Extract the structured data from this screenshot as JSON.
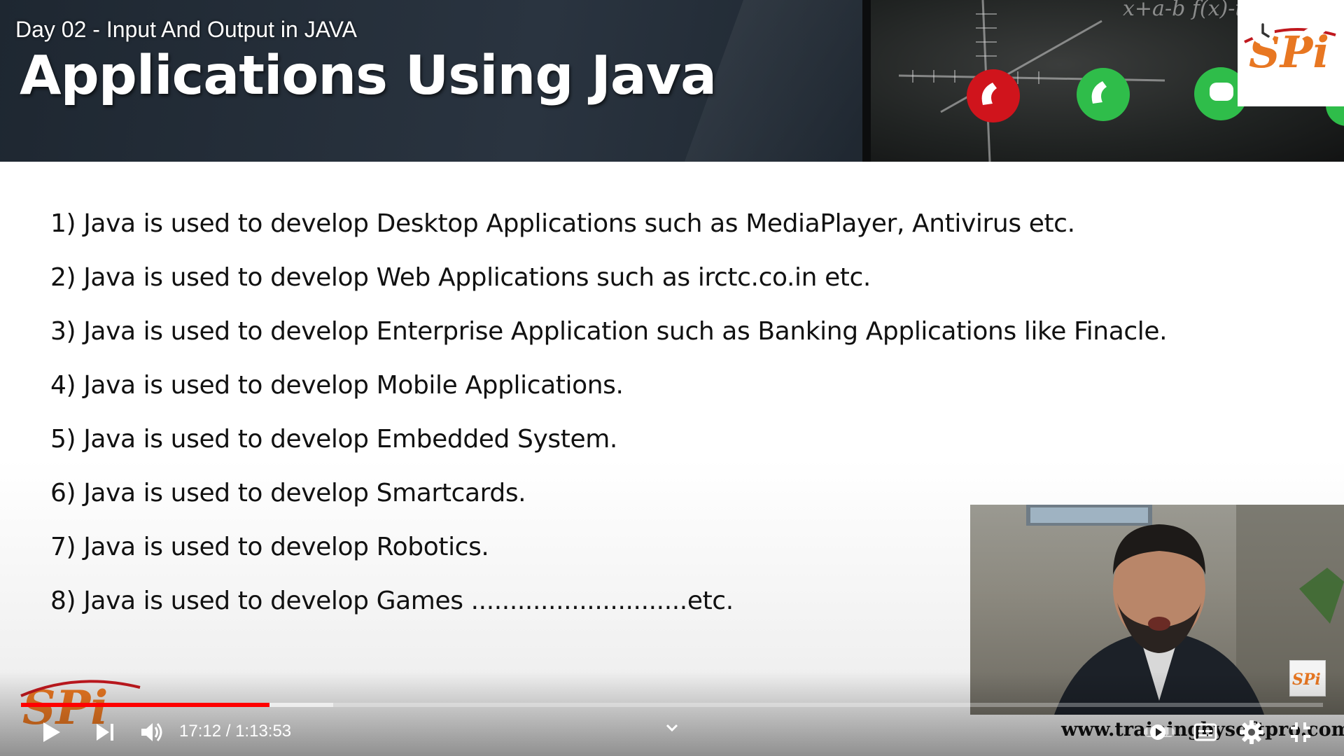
{
  "video": {
    "title": "Day 02 - Input And Output in JAVA",
    "time_current": "17:12",
    "time_separator": "/",
    "time_total": "1:13:53",
    "progress_played_fraction": 0.191,
    "progress_buffered_fraction": 0.24,
    "accent_color": "#ff0000"
  },
  "slide": {
    "heading": "Applications Using Java",
    "points": [
      "1) Java is used to develop Desktop Applications such as MediaPlayer, Antivirus etc.",
      "2) Java is used to develop Web Applications such as irctc.co.in etc.",
      "3) Java is used to develop Enterprise Application such as Banking Applications like Finacle.",
      "4) Java is used to develop Mobile Applications.",
      "5) Java is used to develop Embedded System.",
      "6) Java is used to develop Smartcards.",
      "7) Java is used to develop Robotics.",
      "8) Java is used to develop Games ............................etc."
    ],
    "board_formula": "x+a-b  f(x)-tan",
    "logo_text": "SPi",
    "watermark_url": "www.trainingbysoftpro.com"
  },
  "icons": {
    "watch_later": "clock-icon",
    "share": "share-arrow-icon",
    "play": "play-icon",
    "next": "next-icon",
    "volume": "volume-icon",
    "chapters": "chevron-down-icon",
    "autoplay": "autoplay-toggle-icon",
    "subtitles": "subtitles-icon",
    "settings": "gear-icon",
    "fullscreen": "exit-fullscreen-icon"
  }
}
